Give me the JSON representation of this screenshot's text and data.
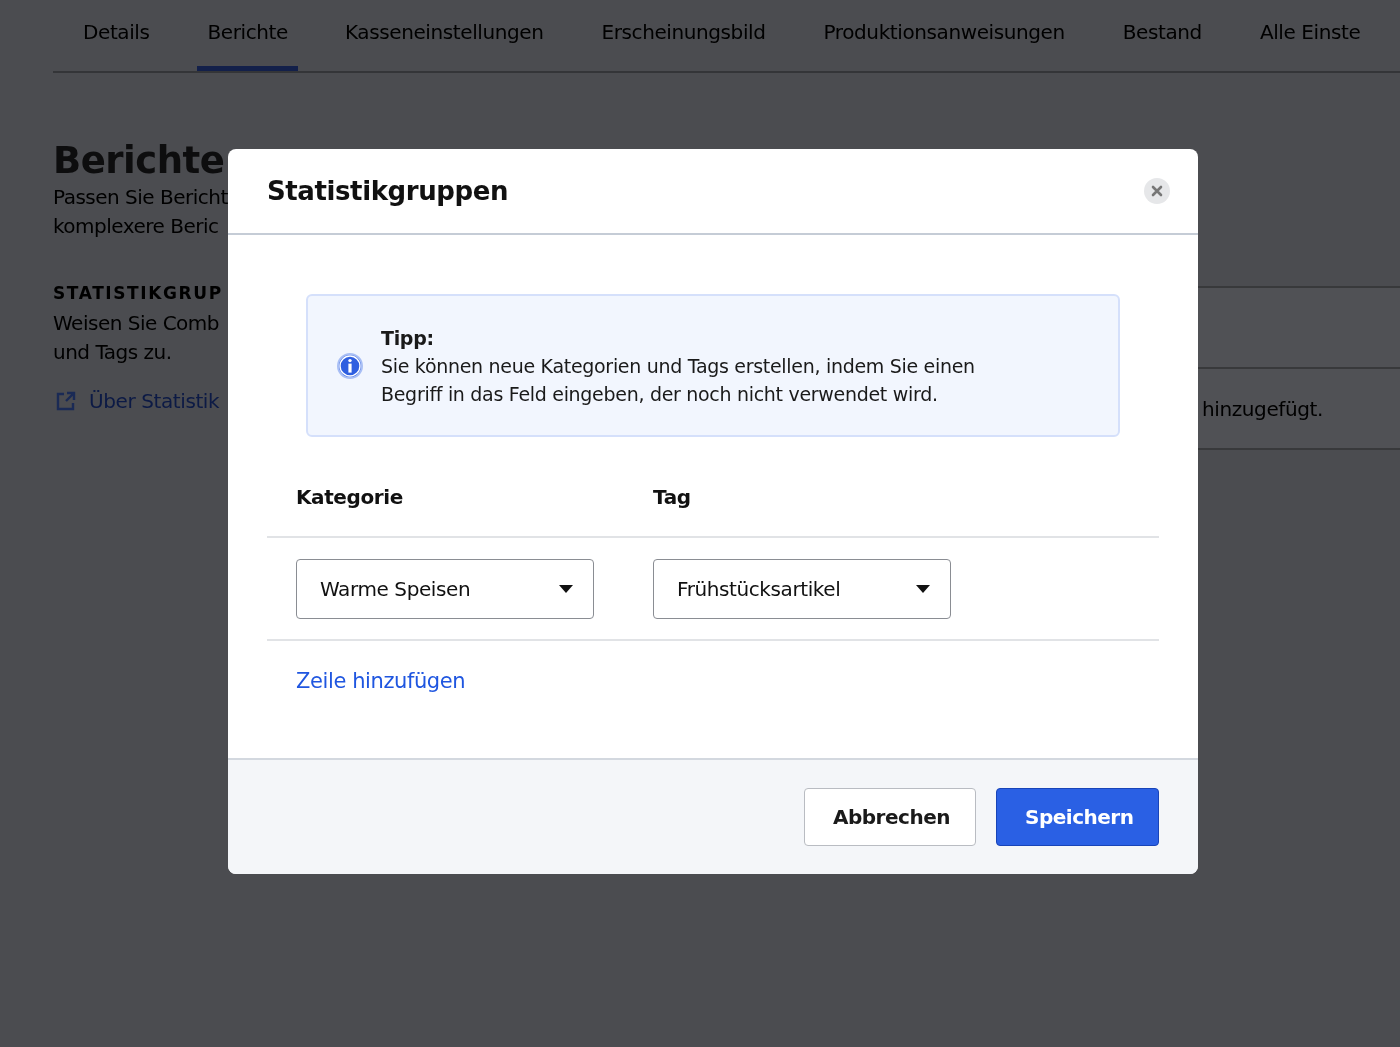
{
  "tabs": [
    {
      "label": "Details",
      "selected": false
    },
    {
      "label": "Berichte",
      "selected": true
    },
    {
      "label": "Kasseneinstellungen",
      "selected": false
    },
    {
      "label": "Erscheinungsbild",
      "selected": false
    },
    {
      "label": "Produktionsanweisungen",
      "selected": false
    },
    {
      "label": "Bestand",
      "selected": false
    },
    {
      "label": "Alle Einste",
      "selected": false
    }
  ],
  "page": {
    "title": "Berichte",
    "description": [
      "Passen Sie Bericht",
      "komplexere Beric"
    ],
    "section_title": "STATISTIKGRUP",
    "section_text": [
      "Weisen Sie Comb",
      "und Tags zu."
    ],
    "link": "Über Statistik"
  },
  "side_card": {
    "text": "hinzugefügt."
  },
  "dialog": {
    "title": "Statistikgruppen",
    "tip": {
      "title": "Tipp:",
      "text": "Sie können neue Kategorien und Tags erstellen, indem Sie einen Begriff in das Feld eingeben, der noch nicht verwendet wird."
    },
    "columns": [
      "Kategorie",
      "Tag"
    ],
    "rows": [
      {
        "category": "Warme Speisen",
        "tag": "Frühstücksartikel"
      }
    ],
    "add_row_link": "Zeile hinzufügen",
    "buttons": [
      {
        "label": "Abbrechen",
        "kind": "secondary"
      },
      {
        "label": "Speichern",
        "kind": "primary"
      }
    ]
  }
}
